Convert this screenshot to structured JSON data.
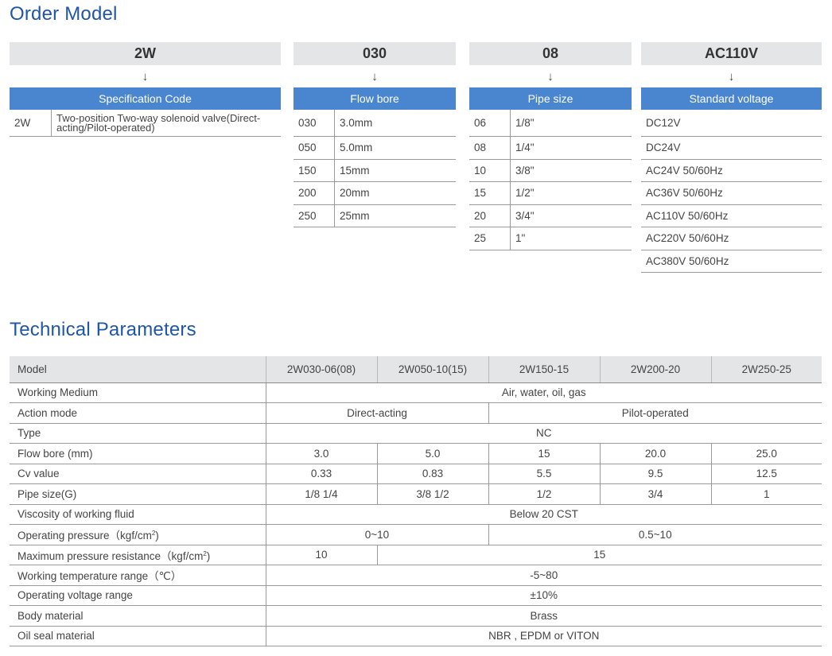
{
  "order_model": {
    "title": "Order Model",
    "arrow": "↓",
    "spec": {
      "code": "2W",
      "header": "Specification  Code",
      "rows": [
        {
          "code": "2W",
          "desc": "Two-position Two-way solenoid valve(Direct-acting/Pilot-operated)"
        }
      ]
    },
    "flow_bore": {
      "code": "030",
      "header": "Flow bore",
      "rows": [
        {
          "code": "030",
          "value": "3.0mm"
        },
        {
          "code": "050",
          "value": "5.0mm"
        },
        {
          "code": "150",
          "value": "15mm"
        },
        {
          "code": "200",
          "value": "20mm"
        },
        {
          "code": "250",
          "value": "25mm"
        }
      ]
    },
    "pipe_size": {
      "code": "08",
      "header": "Pipe size",
      "rows": [
        {
          "code": "06",
          "value": "1/8\""
        },
        {
          "code": "08",
          "value": "1/4\""
        },
        {
          "code": "10",
          "value": "3/8\""
        },
        {
          "code": "15",
          "value": "1/2\""
        },
        {
          "code": "20",
          "value": "3/4\""
        },
        {
          "code": "25",
          "value": "1\""
        }
      ]
    },
    "voltage": {
      "code": "AC110V",
      "header": "Standard voltage",
      "rows": [
        "DC12V",
        "DC24V",
        "AC24V 50/60Hz",
        "AC36V 50/60Hz",
        "AC110V 50/60Hz",
        "AC220V 50/60Hz",
        "AC380V 50/60Hz"
      ]
    }
  },
  "technical": {
    "title": "Technical Parameters",
    "header": {
      "label": "Model",
      "models": [
        "2W030-06(08)",
        "2W050-10(15)",
        "2W150-15",
        "2W200-20",
        "2W250-25"
      ]
    },
    "rows": {
      "working_medium": {
        "label": "Working Medium",
        "value": "Air, water, oil, gas"
      },
      "action_mode": {
        "label": "Action mode",
        "direct": "Direct-acting",
        "pilot": "Pilot-operated"
      },
      "type": {
        "label": "Type",
        "value": "NC"
      },
      "flow_bore": {
        "label": "Flow bore (mm)",
        "values": [
          "3.0",
          "5.0",
          "15",
          "20.0",
          "25.0"
        ]
      },
      "cv_value": {
        "label": "Cv value",
        "values": [
          "0.33",
          "0.83",
          "5.5",
          "9.5",
          "12.5"
        ]
      },
      "pipe_size": {
        "label": "Pipe size(G)",
        "values": [
          "1/8 1/4",
          "3/8  1/2",
          "1/2",
          "3/4",
          "1"
        ]
      },
      "viscosity": {
        "label": "Viscosity of working fluid",
        "value": "Below 20 CST"
      },
      "operating_pressure": {
        "label_pre": "Operating pressure（kgf/cm",
        "label_sup": "2",
        "label_post": ")",
        "direct": "0~10",
        "pilot": "0.5~10"
      },
      "max_pressure": {
        "label_pre": "Maximum pressure resistance（kgf/cm",
        "label_sup": "2",
        "label_post": ")",
        "first": "10",
        "rest": "15"
      },
      "temperature": {
        "label": "Working temperature range（℃）",
        "value": "-5~80"
      },
      "voltage_range": {
        "label": "Operating voltage range",
        "value": "±10%"
      },
      "body_material": {
        "label": "Body material",
        "value": "Brass"
      },
      "oil_seal": {
        "label": "Oil seal material",
        "value": "NBR , EPDM or VITON"
      }
    }
  }
}
